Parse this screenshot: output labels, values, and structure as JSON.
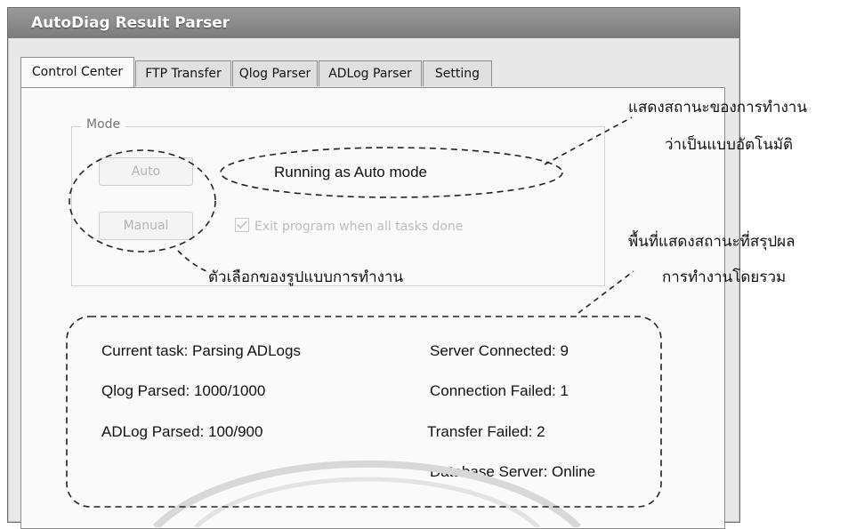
{
  "window": {
    "title": "AutoDiag Result Parser"
  },
  "tabs": [
    {
      "label": "Control Center",
      "active": true
    },
    {
      "label": "FTP Transfer",
      "active": false
    },
    {
      "label": "Qlog Parser",
      "active": false
    },
    {
      "label": "ADLog Parser",
      "active": false
    },
    {
      "label": "Setting",
      "active": false
    }
  ],
  "mode_group": {
    "label": "Mode",
    "auto_button": "Auto",
    "manual_button": "Manual",
    "exit_checkbox": {
      "label": "Exit program when all tasks done",
      "checked": true,
      "enabled": false
    },
    "status": "Running as Auto mode"
  },
  "summary": {
    "current_task": "Current task: Parsing ADLogs",
    "qlog_parsed": "Qlog Parsed: 1000/1000",
    "adlog_parsed": "ADLog Parsed: 100/900",
    "server_connected": "Server Connected: 9",
    "connection_failed": "Connection Failed: 1",
    "transfer_failed": "Transfer Failed: 2",
    "database_server": "Database Server: Online"
  },
  "annotations": {
    "status_note_line1": "แสดงสถานะของการทำงาน",
    "status_note_line2": "ว่าเป็นแบบอัตโนมัติ",
    "mode_note": "ตัวเลือกของรูปแบบการทำงาน",
    "summary_note_line1": "พื้นที่แสดงสถานะที่สรุปผล",
    "summary_note_line2": "การทำงานโดยรวม"
  },
  "colors": {
    "titlebar": "#8a8a8a",
    "panel": "#fafafa",
    "disabled_text": "#b5b5b5"
  }
}
